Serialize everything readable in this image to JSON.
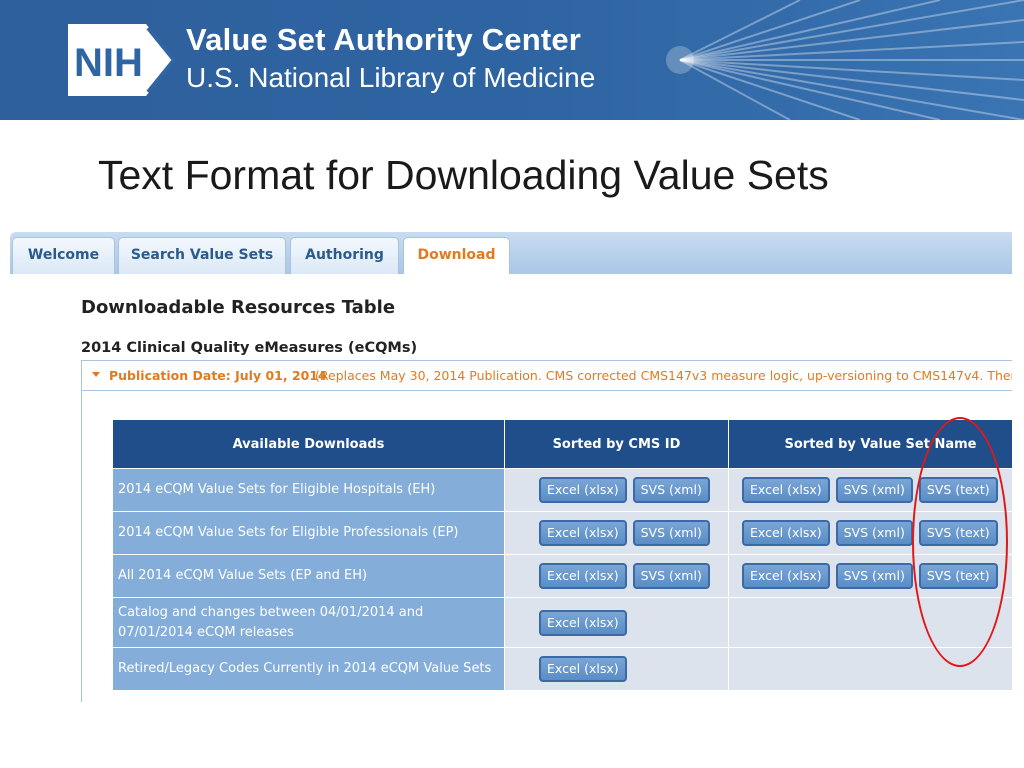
{
  "banner": {
    "logo_text": "NIH",
    "title": "Value Set Authority Center",
    "subtitle": "U.S. National Library of Medicine"
  },
  "slide": {
    "title": "Text Format for Downloading Value Sets"
  },
  "tabs": [
    {
      "label": "Welcome",
      "active": false
    },
    {
      "label": "Search Value Sets",
      "active": false
    },
    {
      "label": "Authoring",
      "active": false
    },
    {
      "label": "Download",
      "active": true
    }
  ],
  "page": {
    "title": "Downloadable Resources Table",
    "section_heading": "2014 Clinical Quality eMeasures (eCQMs)",
    "publication_date": "Publication Date: July 01, 2014",
    "publication_note": "(Replaces May 30, 2014 Publication. CMS corrected CMS147v3 measure logic, up-versioning to CMS147v4. Ther"
  },
  "table": {
    "headers": [
      "Available Downloads",
      "Sorted by CMS ID",
      "Sorted by Value Set Name"
    ],
    "rows": [
      {
        "label": "2014 eCQM Value Sets for Eligible Hospitals (EH)",
        "cms": [
          "Excel (xlsx)",
          "SVS (xml)"
        ],
        "name": [
          "Excel (xlsx)",
          "SVS (xml)",
          "SVS (text)"
        ]
      },
      {
        "label": "2014 eCQM Value Sets for Eligible Professionals (EP)",
        "cms": [
          "Excel (xlsx)",
          "SVS (xml)"
        ],
        "name": [
          "Excel (xlsx)",
          "SVS (xml)",
          "SVS (text)"
        ]
      },
      {
        "label": "All 2014 eCQM Value Sets (EP and EH)",
        "cms": [
          "Excel (xlsx)",
          "SVS (xml)"
        ],
        "name": [
          "Excel (xlsx)",
          "SVS (xml)",
          "SVS (text)"
        ]
      },
      {
        "label": "Catalog and changes between 04/01/2014 and 07/01/2014 eCQM releases",
        "cms": [
          "Excel (xlsx)"
        ],
        "name": []
      },
      {
        "label": "Retired/Legacy Codes Currently in 2014 eCQM Value Sets",
        "cms": [
          "Excel (xlsx)"
        ],
        "name": []
      }
    ]
  },
  "colors": {
    "banner_blue": "#2f65a3",
    "header_navy": "#1f4e8a",
    "label_blue": "#84aed9",
    "accent_orange": "#e07b1f",
    "highlight_red": "#e01818"
  }
}
